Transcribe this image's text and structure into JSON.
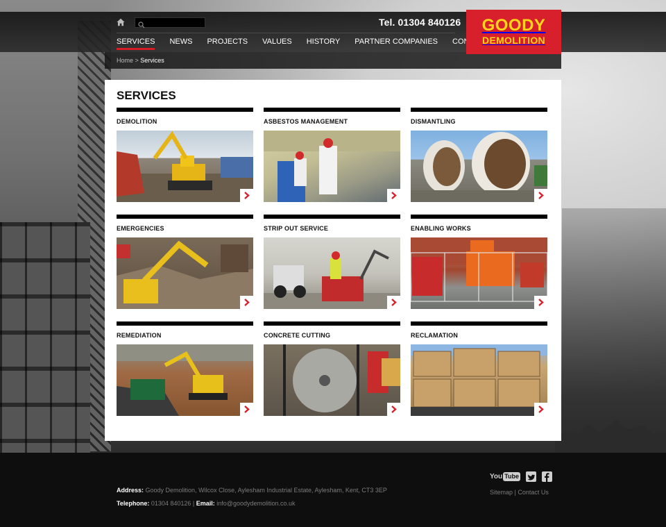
{
  "header": {
    "phone": "Tel. 01304 840126",
    "search_placeholder": "",
    "logo": {
      "line1": "GOODY",
      "line2": "DEMOLITION"
    },
    "nav": [
      {
        "label": "SERVICES",
        "active": true
      },
      {
        "label": "NEWS"
      },
      {
        "label": "PROJECTS"
      },
      {
        "label": "VALUES"
      },
      {
        "label": "HISTORY"
      },
      {
        "label": "PARTNER COMPANIES"
      },
      {
        "label": "CONTACT"
      }
    ]
  },
  "breadcrumb": {
    "home": "Home",
    "separator": " > ",
    "current": "Services"
  },
  "page": {
    "title": "SERVICES",
    "services": [
      {
        "title": "DEMOLITION",
        "image": "excavator on demolition rubble"
      },
      {
        "title": "ASBESTOS MANAGEMENT",
        "image": "workers in protective suits removing asbestos"
      },
      {
        "title": "DISMANTLING",
        "image": "large tunnel boring rings"
      },
      {
        "title": "EMERGENCIES",
        "image": "excavator clearing collapsed building"
      },
      {
        "title": "STRIP OUT SERVICE",
        "image": "skid steer and mini excavator indoors"
      },
      {
        "title": "ENABLING WORKS",
        "image": "orange tracked rig behind fencing"
      },
      {
        "title": "REMEDIATION",
        "image": "excavator loading soil into truck"
      },
      {
        "title": "CONCRETE CUTTING",
        "image": "wire saw cutting concrete"
      },
      {
        "title": "RECLAMATION",
        "image": "pallets of reclaimed bricks"
      }
    ]
  },
  "footer": {
    "address_label": "Address:",
    "address": "Goody Demolition, Wilcox Close, Aylesham Industrial Estate, Aylesham, Kent, CT3 3EP",
    "telephone_label": "Telephone:",
    "telephone": "01304 840126",
    "email_label": "Email:",
    "email": "info@goodydemolition.co.uk",
    "divider": " | ",
    "youtube": {
      "you": "You",
      "tube": "Tube"
    },
    "links": [
      {
        "label": "Sitemap"
      },
      {
        "label": "Contact Us"
      }
    ]
  },
  "colors": {
    "accent_red": "#d7202b",
    "logo_yellow": "#ffd41a",
    "footer_bg": "#0e0e0e",
    "nav_active_underline": "#d41d27"
  },
  "icons": {
    "home": "home-icon",
    "search": "search-icon",
    "arrow": "chevron-right-icon",
    "twitter": "twitter-icon",
    "facebook": "facebook-icon"
  }
}
